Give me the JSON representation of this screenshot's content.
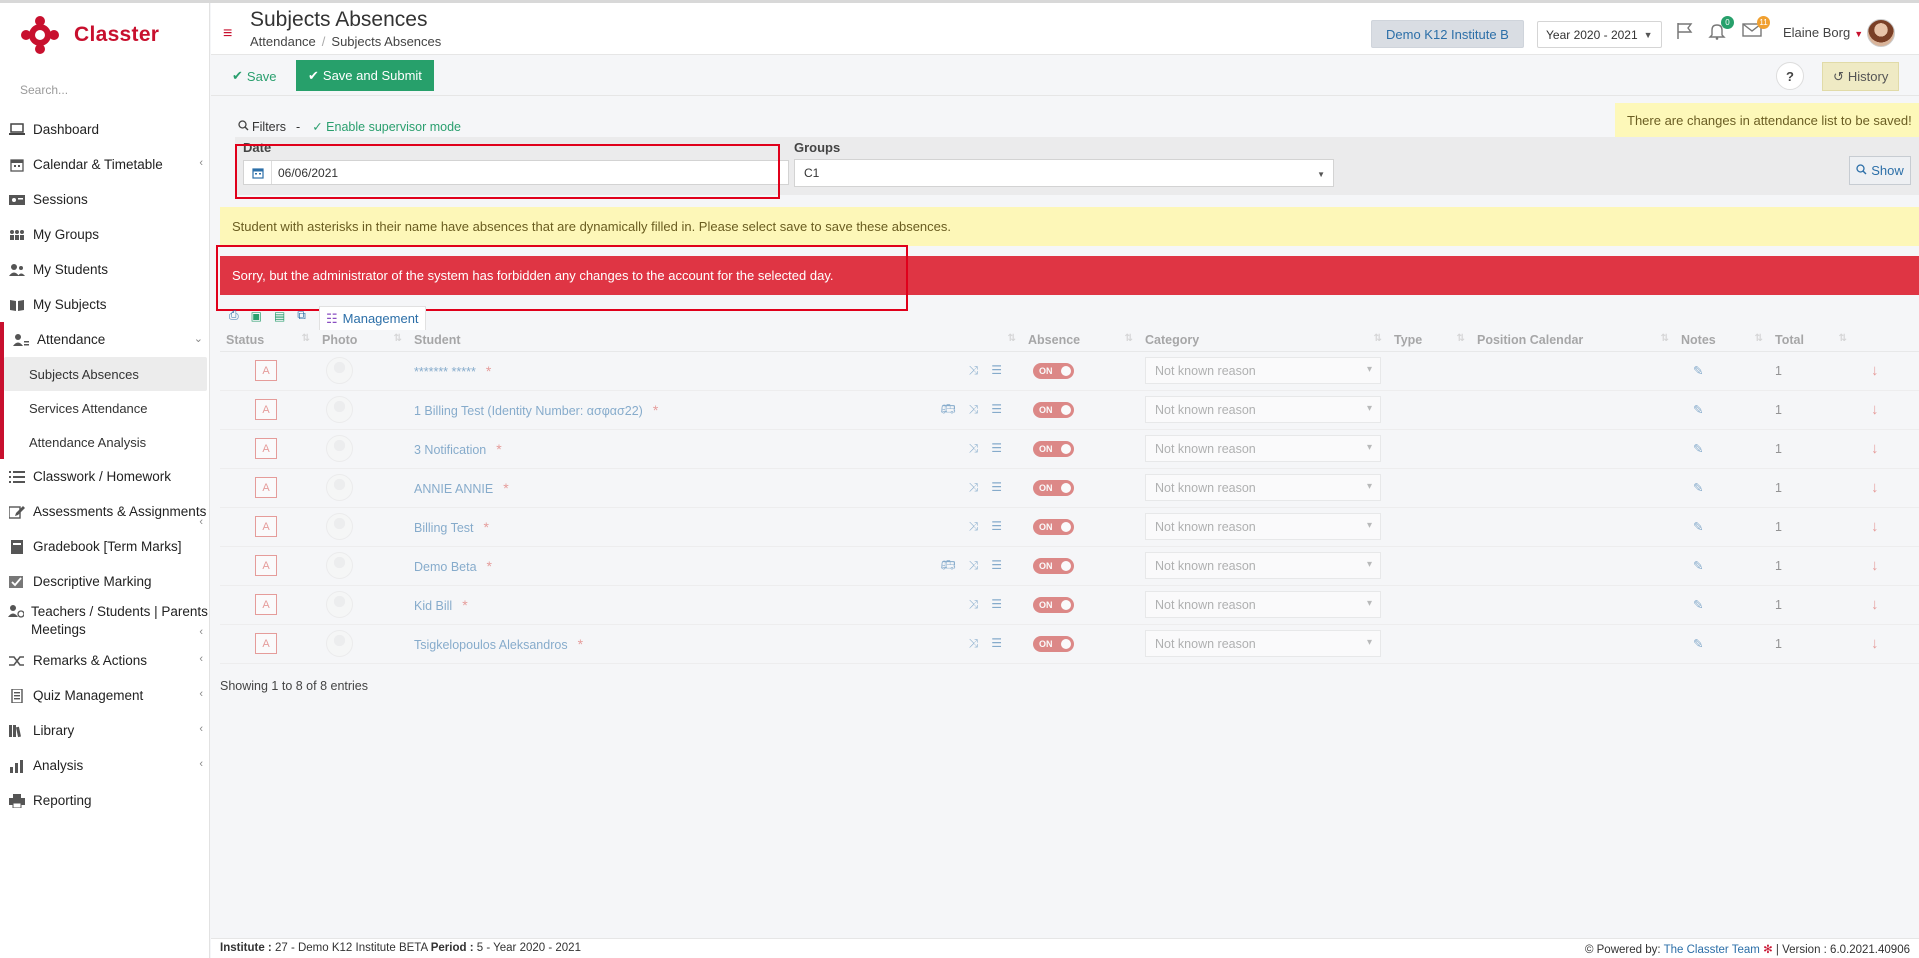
{
  "app": {
    "brand": "Classter",
    "brand_color": "#c8102e"
  },
  "search": {
    "placeholder": "Search..."
  },
  "sidebar": {
    "items": [
      {
        "label": "Dashboard",
        "icon": "laptop-icon"
      },
      {
        "label": "Calendar & Timetable",
        "icon": "calendar-icon"
      },
      {
        "label": "Sessions",
        "icon": "sessions-icon"
      },
      {
        "label": "My Groups",
        "icon": "groups-icon"
      },
      {
        "label": "My Students",
        "icon": "students-icon"
      },
      {
        "label": "My Subjects",
        "icon": "book-icon"
      },
      {
        "label": "Attendance",
        "icon": "attendance-icon"
      },
      {
        "label": "Classwork / Homework",
        "icon": "list-icon"
      },
      {
        "label": "Assessments & Assignments",
        "icon": "edit-icon"
      },
      {
        "label": "Gradebook [Term Marks]",
        "icon": "gradebook-icon"
      },
      {
        "label": "Descriptive Marking",
        "icon": "marking-icon"
      },
      {
        "label": "Teachers / Students | Parents Meetings",
        "icon": "meetings-icon"
      },
      {
        "label": "Remarks & Actions",
        "icon": "shuffle-icon"
      },
      {
        "label": "Quiz Management",
        "icon": "quiz-icon"
      },
      {
        "label": "Library",
        "icon": "library-icon"
      },
      {
        "label": "Analysis",
        "icon": "analysis-icon"
      },
      {
        "label": "Reporting",
        "icon": "printer-icon"
      }
    ],
    "attendance_sub": [
      "Subjects Absences",
      "Services Attendance",
      "Attendance Analysis"
    ]
  },
  "header": {
    "title": "Subjects Absences",
    "breadcrumb": [
      "Attendance",
      "Subjects Absences"
    ],
    "institute": "Demo K12 Institute B",
    "year": "Year 2020 - 2021",
    "notifications": "0",
    "messages": "11",
    "user": "Elaine Borg"
  },
  "toolbar": {
    "save": "Save",
    "save_submit": "Save and Submit",
    "help": "?",
    "history": "History"
  },
  "filters": {
    "label": "Filters",
    "dash": "-",
    "supervisor": "Enable supervisor mode",
    "date_label": "Date",
    "date_value": "06/06/2021",
    "groups_label": "Groups",
    "groups_value": "C1",
    "show": "Show"
  },
  "alerts": {
    "changes": "There are changes in attendance list to be saved!",
    "asterisk_info": "Student with asterisks in their name have absences that are dynamically filled in. Please select save to save these absences.",
    "error": "Sorry, but the administrator of the system has forbidden any changes to the account for the selected day."
  },
  "table": {
    "management": "Management",
    "columns": [
      "Status",
      "Photo",
      "Student",
      "Absence",
      "Category",
      "Type",
      "Position Calendar",
      "Notes",
      "Total"
    ],
    "status_label": "A",
    "toggle_label": "ON",
    "category_default": "Not known reason",
    "rows": [
      {
        "student": "******* *****",
        "bus": false,
        "total": "1"
      },
      {
        "student": "1 Billing Test (Identity Number: ασφασ22)",
        "bus": true,
        "total": "1"
      },
      {
        "student": "3 Notification",
        "bus": false,
        "total": "1"
      },
      {
        "student": "ANNIE ANNIE",
        "bus": false,
        "total": "1"
      },
      {
        "student": "Billing Test",
        "bus": false,
        "total": "1"
      },
      {
        "student": "Demo Beta",
        "bus": true,
        "total": "1"
      },
      {
        "student": "Kid Bill",
        "bus": false,
        "total": "1"
      },
      {
        "student": "Tsigkelopoulos Aleksandros",
        "bus": false,
        "total": "1"
      }
    ],
    "asterisk": "*",
    "showing": "Showing 1 to 8 of 8 entries"
  },
  "footer": {
    "institute_label": "Institute :",
    "institute_value": "27 - Demo K12 Institute BETA",
    "period_label": "Period :",
    "period_value": "5 - Year 2020 - 2021",
    "powered_by": "Powered by:",
    "team": "The Classter Team",
    "version": "| Version : 6.0.2021.40906"
  }
}
